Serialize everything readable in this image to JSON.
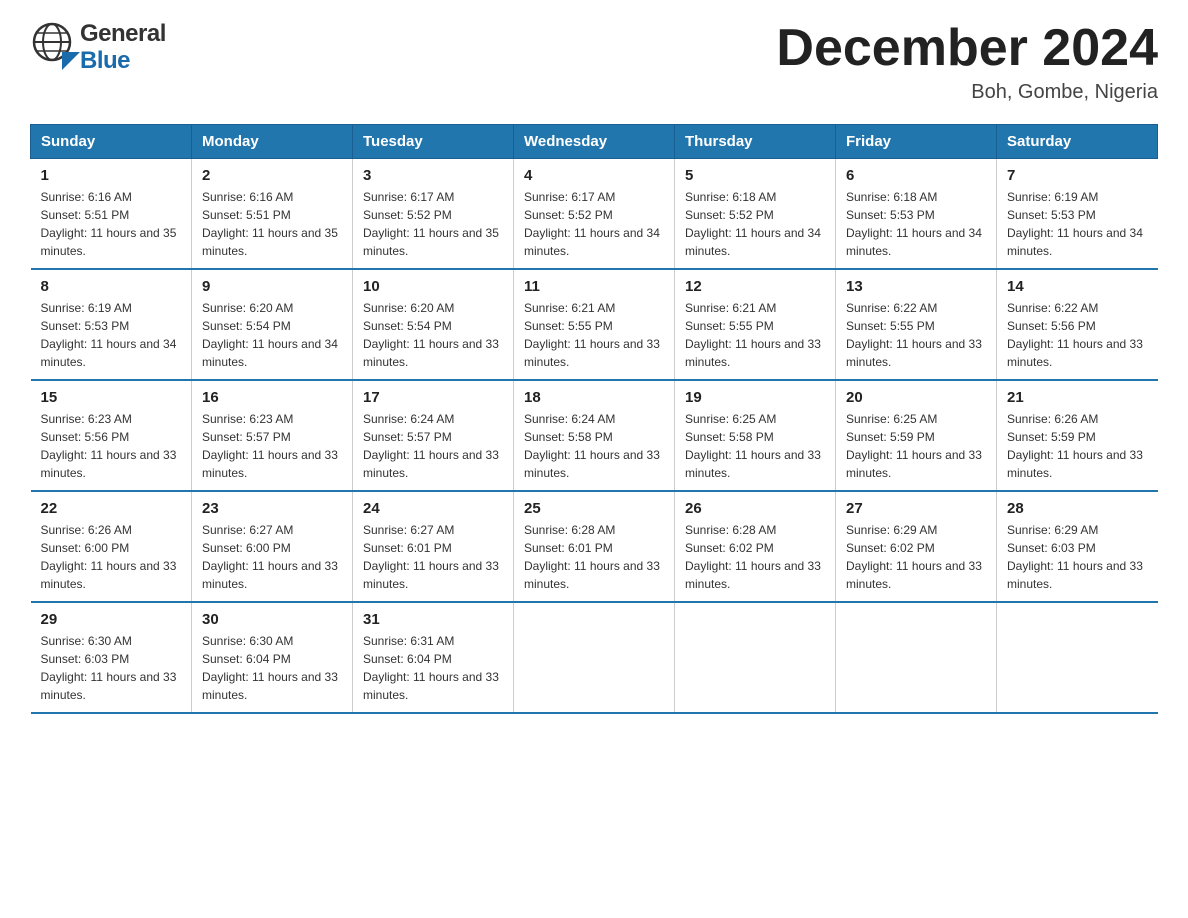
{
  "header": {
    "logo_general": "General",
    "logo_blue": "Blue",
    "month_title": "December 2024",
    "location": "Boh, Gombe, Nigeria"
  },
  "columns": [
    "Sunday",
    "Monday",
    "Tuesday",
    "Wednesday",
    "Thursday",
    "Friday",
    "Saturday"
  ],
  "weeks": [
    [
      {
        "day": "1",
        "sunrise": "Sunrise: 6:16 AM",
        "sunset": "Sunset: 5:51 PM",
        "daylight": "Daylight: 11 hours and 35 minutes."
      },
      {
        "day": "2",
        "sunrise": "Sunrise: 6:16 AM",
        "sunset": "Sunset: 5:51 PM",
        "daylight": "Daylight: 11 hours and 35 minutes."
      },
      {
        "day": "3",
        "sunrise": "Sunrise: 6:17 AM",
        "sunset": "Sunset: 5:52 PM",
        "daylight": "Daylight: 11 hours and 35 minutes."
      },
      {
        "day": "4",
        "sunrise": "Sunrise: 6:17 AM",
        "sunset": "Sunset: 5:52 PM",
        "daylight": "Daylight: 11 hours and 34 minutes."
      },
      {
        "day": "5",
        "sunrise": "Sunrise: 6:18 AM",
        "sunset": "Sunset: 5:52 PM",
        "daylight": "Daylight: 11 hours and 34 minutes."
      },
      {
        "day": "6",
        "sunrise": "Sunrise: 6:18 AM",
        "sunset": "Sunset: 5:53 PM",
        "daylight": "Daylight: 11 hours and 34 minutes."
      },
      {
        "day": "7",
        "sunrise": "Sunrise: 6:19 AM",
        "sunset": "Sunset: 5:53 PM",
        "daylight": "Daylight: 11 hours and 34 minutes."
      }
    ],
    [
      {
        "day": "8",
        "sunrise": "Sunrise: 6:19 AM",
        "sunset": "Sunset: 5:53 PM",
        "daylight": "Daylight: 11 hours and 34 minutes."
      },
      {
        "day": "9",
        "sunrise": "Sunrise: 6:20 AM",
        "sunset": "Sunset: 5:54 PM",
        "daylight": "Daylight: 11 hours and 34 minutes."
      },
      {
        "day": "10",
        "sunrise": "Sunrise: 6:20 AM",
        "sunset": "Sunset: 5:54 PM",
        "daylight": "Daylight: 11 hours and 33 minutes."
      },
      {
        "day": "11",
        "sunrise": "Sunrise: 6:21 AM",
        "sunset": "Sunset: 5:55 PM",
        "daylight": "Daylight: 11 hours and 33 minutes."
      },
      {
        "day": "12",
        "sunrise": "Sunrise: 6:21 AM",
        "sunset": "Sunset: 5:55 PM",
        "daylight": "Daylight: 11 hours and 33 minutes."
      },
      {
        "day": "13",
        "sunrise": "Sunrise: 6:22 AM",
        "sunset": "Sunset: 5:55 PM",
        "daylight": "Daylight: 11 hours and 33 minutes."
      },
      {
        "day": "14",
        "sunrise": "Sunrise: 6:22 AM",
        "sunset": "Sunset: 5:56 PM",
        "daylight": "Daylight: 11 hours and 33 minutes."
      }
    ],
    [
      {
        "day": "15",
        "sunrise": "Sunrise: 6:23 AM",
        "sunset": "Sunset: 5:56 PM",
        "daylight": "Daylight: 11 hours and 33 minutes."
      },
      {
        "day": "16",
        "sunrise": "Sunrise: 6:23 AM",
        "sunset": "Sunset: 5:57 PM",
        "daylight": "Daylight: 11 hours and 33 minutes."
      },
      {
        "day": "17",
        "sunrise": "Sunrise: 6:24 AM",
        "sunset": "Sunset: 5:57 PM",
        "daylight": "Daylight: 11 hours and 33 minutes."
      },
      {
        "day": "18",
        "sunrise": "Sunrise: 6:24 AM",
        "sunset": "Sunset: 5:58 PM",
        "daylight": "Daylight: 11 hours and 33 minutes."
      },
      {
        "day": "19",
        "sunrise": "Sunrise: 6:25 AM",
        "sunset": "Sunset: 5:58 PM",
        "daylight": "Daylight: 11 hours and 33 minutes."
      },
      {
        "day": "20",
        "sunrise": "Sunrise: 6:25 AM",
        "sunset": "Sunset: 5:59 PM",
        "daylight": "Daylight: 11 hours and 33 minutes."
      },
      {
        "day": "21",
        "sunrise": "Sunrise: 6:26 AM",
        "sunset": "Sunset: 5:59 PM",
        "daylight": "Daylight: 11 hours and 33 minutes."
      }
    ],
    [
      {
        "day": "22",
        "sunrise": "Sunrise: 6:26 AM",
        "sunset": "Sunset: 6:00 PM",
        "daylight": "Daylight: 11 hours and 33 minutes."
      },
      {
        "day": "23",
        "sunrise": "Sunrise: 6:27 AM",
        "sunset": "Sunset: 6:00 PM",
        "daylight": "Daylight: 11 hours and 33 minutes."
      },
      {
        "day": "24",
        "sunrise": "Sunrise: 6:27 AM",
        "sunset": "Sunset: 6:01 PM",
        "daylight": "Daylight: 11 hours and 33 minutes."
      },
      {
        "day": "25",
        "sunrise": "Sunrise: 6:28 AM",
        "sunset": "Sunset: 6:01 PM",
        "daylight": "Daylight: 11 hours and 33 minutes."
      },
      {
        "day": "26",
        "sunrise": "Sunrise: 6:28 AM",
        "sunset": "Sunset: 6:02 PM",
        "daylight": "Daylight: 11 hours and 33 minutes."
      },
      {
        "day": "27",
        "sunrise": "Sunrise: 6:29 AM",
        "sunset": "Sunset: 6:02 PM",
        "daylight": "Daylight: 11 hours and 33 minutes."
      },
      {
        "day": "28",
        "sunrise": "Sunrise: 6:29 AM",
        "sunset": "Sunset: 6:03 PM",
        "daylight": "Daylight: 11 hours and 33 minutes."
      }
    ],
    [
      {
        "day": "29",
        "sunrise": "Sunrise: 6:30 AM",
        "sunset": "Sunset: 6:03 PM",
        "daylight": "Daylight: 11 hours and 33 minutes."
      },
      {
        "day": "30",
        "sunrise": "Sunrise: 6:30 AM",
        "sunset": "Sunset: 6:04 PM",
        "daylight": "Daylight: 11 hours and 33 minutes."
      },
      {
        "day": "31",
        "sunrise": "Sunrise: 6:31 AM",
        "sunset": "Sunset: 6:04 PM",
        "daylight": "Daylight: 11 hours and 33 minutes."
      },
      null,
      null,
      null,
      null
    ]
  ]
}
